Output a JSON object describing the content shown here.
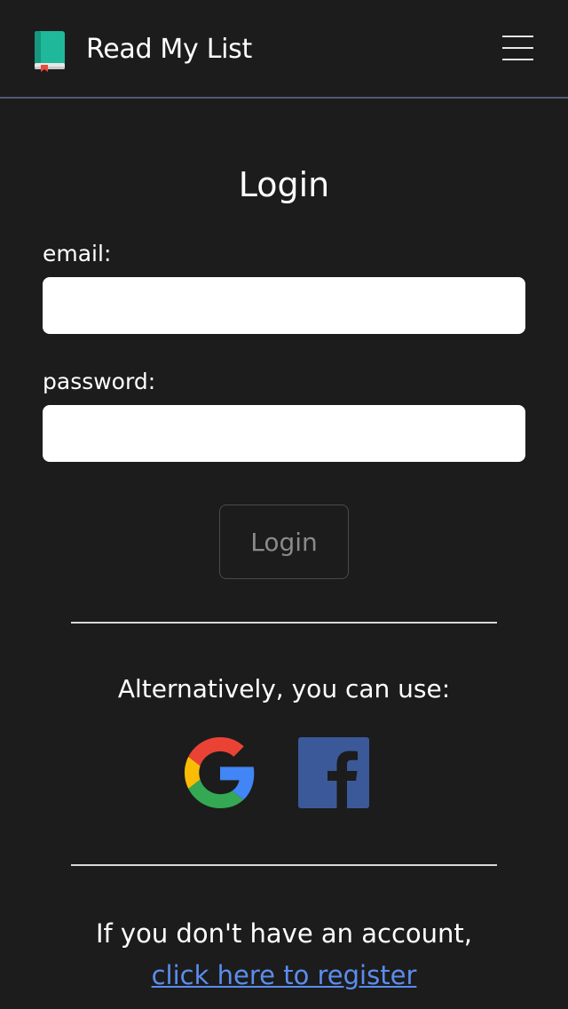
{
  "navbar": {
    "brand_title": "Read My List",
    "brand_icon": "book-icon",
    "menu_icon": "hamburger-menu-icon"
  },
  "login_form": {
    "title": "Login",
    "email_label": "email:",
    "email_value": "",
    "password_label": "password:",
    "password_value": "",
    "submit_label": "Login"
  },
  "alternatives": {
    "text": "Alternatively, you can use:",
    "providers": [
      "google-icon",
      "facebook-icon"
    ]
  },
  "register": {
    "text": "If you don't have an account,",
    "link_text": "click here to register"
  },
  "colors": {
    "background": "#1c1c1c",
    "navbar_border": "#4f5b74",
    "link": "#5b8dee",
    "brand_book": "#1fb89a",
    "facebook": "#3b5998"
  }
}
